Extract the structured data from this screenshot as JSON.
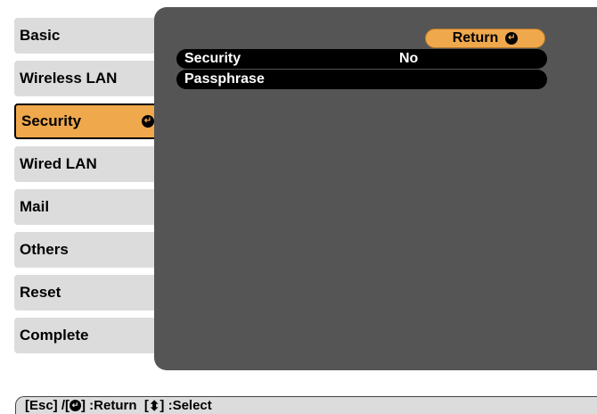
{
  "sidebar": {
    "items": [
      {
        "label": "Basic"
      },
      {
        "label": "Wireless LAN"
      },
      {
        "label": "Security",
        "active": true
      },
      {
        "label": "Wired LAN"
      },
      {
        "label": "Mail"
      },
      {
        "label": "Others"
      },
      {
        "label": "Reset"
      },
      {
        "label": "Complete"
      }
    ]
  },
  "panel": {
    "return_label": "Return",
    "rows": [
      {
        "label": "Security",
        "value": "No"
      },
      {
        "label": "Passphrase",
        "value": ""
      }
    ]
  },
  "status": {
    "part1": "[Esc] /[",
    "part2": "] :Return  [",
    "part3": "] :Select"
  },
  "icons": {
    "enter": "enter-icon",
    "updown": "updown-arrow-icon"
  },
  "colors": {
    "accent": "#efa84c",
    "panel_bg": "#555555",
    "menu_bg": "#dcdcdc",
    "row_bg": "#000000"
  }
}
